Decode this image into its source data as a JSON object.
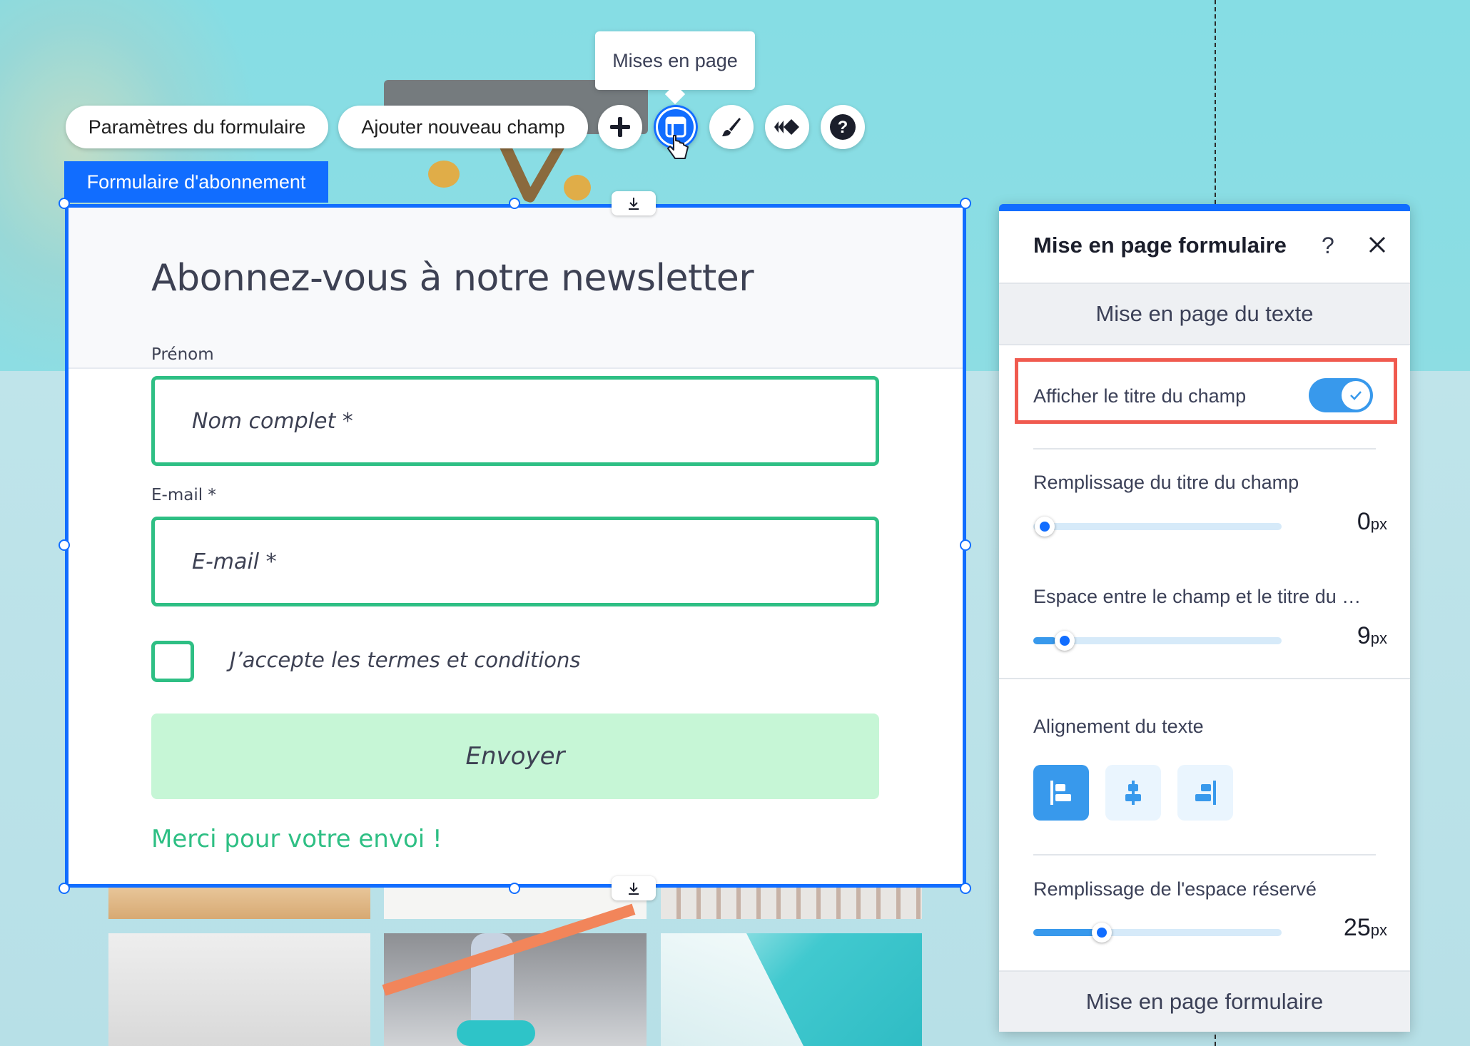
{
  "toolbar": {
    "form_settings_label": "Paramètres du formulaire",
    "add_field_label": "Ajouter nouveau champ",
    "tooltip": "Mises en page",
    "icons": [
      "plus-icon",
      "layout-icon",
      "brush-icon",
      "animation-icon",
      "help-icon"
    ]
  },
  "form": {
    "tag": "Formulaire d'abonnement",
    "title": "Abonnez-vous à notre newsletter",
    "first_name_label": "Prénom",
    "first_name_placeholder": "Nom complet *",
    "email_label": "E-mail *",
    "email_placeholder": "E-mail *",
    "terms_text": "J’accepte les termes et conditions",
    "submit_label": "Envoyer",
    "success_message": "Merci pour votre envoi !",
    "accent_color": "#2ebf84",
    "submit_color": "#c6f6d6"
  },
  "panel": {
    "title": "Mise en page formulaire",
    "help": "?",
    "section_label": "Mise en page du texte",
    "show_field_title_label": "Afficher le titre du champ",
    "show_field_title_enabled": true,
    "field_title_padding": {
      "label": "Remplissage du titre du champ",
      "value": "0",
      "unit": "px",
      "fraction": 0.0
    },
    "field_title_spacing": {
      "label": "Espace entre le champ et le titre du …",
      "value": "9",
      "unit": "px",
      "fraction": 0.09
    },
    "text_alignment": {
      "label": "Alignement du texte",
      "options": [
        "align-left-icon",
        "align-center-icon",
        "align-right-icon"
      ],
      "selected": "align-left-icon"
    },
    "placeholder_padding": {
      "label": "Remplissage de l'espace réservé",
      "value": "25",
      "unit": "px",
      "fraction": 0.27
    },
    "footer_label": "Mise en page formulaire",
    "accent_color": "#116dff",
    "toggle_color": "#3899ec",
    "highlight_color": "#f05a4f"
  }
}
